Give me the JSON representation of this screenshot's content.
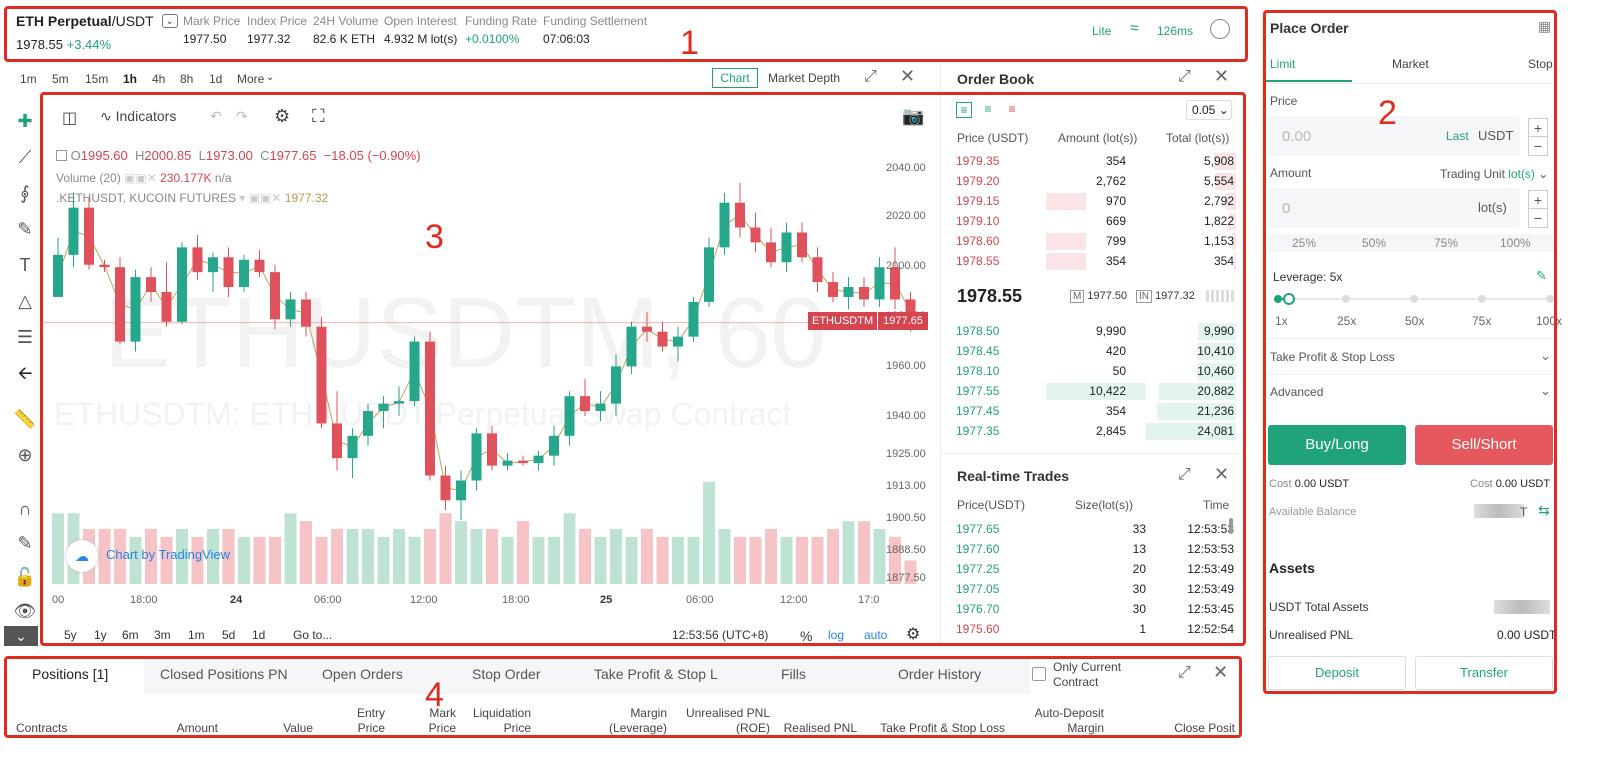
{
  "annotations": [
    "1",
    "2",
    "3",
    "4"
  ],
  "header": {
    "symbol": "ETH Perpetual",
    "quote": "/USDT",
    "last_price": "1978.55",
    "change": "+3.44%",
    "stats": [
      {
        "label": "Mark Price",
        "value": "1977.50"
      },
      {
        "label": "Index Price",
        "value": "1977.32"
      },
      {
        "label": "24H Volume",
        "value": "82.6 K ETH"
      },
      {
        "label": "Open Interest",
        "value": "4.932 M lot(s)"
      },
      {
        "label": "Funding Rate",
        "value": "+0.0100%"
      },
      {
        "label": "Funding Settlement",
        "value": "07:06:03"
      }
    ],
    "mode": "Lite",
    "latency": "126ms"
  },
  "timeframes": [
    "1m",
    "5m",
    "15m",
    "1h",
    "4h",
    "8h",
    "1d",
    "More"
  ],
  "chart_tabs": {
    "chart": "Chart",
    "depth": "Market Depth"
  },
  "chart": {
    "indicators_label": "Indicators",
    "ohlc": {
      "o_label": "O",
      "o": "1995.60",
      "h_label": "H",
      "h": "2000.85",
      "l_label": "L",
      "l": "1973.00",
      "c_label": "C",
      "c": "1977.65",
      "chg": "−18.05 (−0.90%)"
    },
    "volume_label": "Volume (20)",
    "volume_value": "230.177K",
    "volume_na": "n/a",
    "compare_label": ".KETHUSDT, KUCOIN FUTURES",
    "compare_value": "1977.32",
    "watermark_big": "ETHUSDTM, 60",
    "watermark_small": "ETHUSDTM: ETH / USDT Perpetual Swap Contract",
    "price_tag_label": "ETHUSDTM",
    "price_tag_value": "1977.65",
    "y_ticks": [
      "2040.00",
      "2020.00",
      "2000.00",
      "1980.00",
      "1960.00",
      "1940.00",
      "1925.00",
      "1913.00",
      "1900.50",
      "1888.50",
      "1877.50"
    ],
    "x_ticks": [
      "00",
      "18:00",
      "24",
      "06:00",
      "12:00",
      "18:00",
      "25",
      "06:00",
      "12:00",
      "17:0"
    ],
    "tradingview": "Chart by TradingView",
    "ranges": [
      "5y",
      "1y",
      "6m",
      "3m",
      "1m",
      "5d",
      "1d"
    ],
    "goto": "Go to...",
    "clock": "12:53:56 (UTC+8)",
    "pct": "%",
    "log": "log",
    "auto": "auto"
  },
  "chart_data": {
    "type": "candlestick",
    "ohlc": [
      [
        1988,
        2012,
        1990,
        2005
      ],
      [
        2005,
        2030,
        2000,
        2024
      ],
      [
        2024,
        2028,
        1999,
        2001
      ],
      [
        2001,
        2003,
        1998,
        2000
      ],
      [
        2000,
        2004,
        1969,
        1970
      ],
      [
        1970,
        1999,
        1966,
        1996
      ],
      [
        1996,
        2000,
        1986,
        1990
      ],
      [
        1990,
        2002,
        1976,
        1978
      ],
      [
        1978,
        2010,
        1977,
        2008
      ],
      [
        2008,
        2013,
        1995,
        1998
      ],
      [
        1998,
        2006,
        1990,
        2004
      ],
      [
        2004,
        2008,
        1988,
        1992
      ],
      [
        1992,
        2005,
        1990,
        2003
      ],
      [
        2003,
        2007,
        1996,
        1998
      ],
      [
        1998,
        2001,
        1975,
        1979
      ],
      [
        1979,
        1990,
        1976,
        1987
      ],
      [
        1987,
        1990,
        1972,
        1976
      ],
      [
        1976,
        1980,
        1935,
        1937
      ],
      [
        1937,
        1950,
        1918,
        1923
      ],
      [
        1923,
        1935,
        1915,
        1932
      ],
      [
        1932,
        1945,
        1928,
        1942
      ],
      [
        1942,
        1948,
        1935,
        1945
      ],
      [
        1945,
        1952,
        1940,
        1946
      ],
      [
        1946,
        1972,
        1944,
        1970
      ],
      [
        1970,
        1974,
        1914,
        1916
      ],
      [
        1916,
        1920,
        1902,
        1906
      ],
      [
        1906,
        1918,
        1898,
        1914
      ],
      [
        1914,
        1935,
        1910,
        1933
      ],
      [
        1933,
        1936,
        1918,
        1920
      ],
      [
        1920,
        1925,
        1918,
        1922
      ],
      [
        1922,
        1924,
        1920,
        1921
      ],
      [
        1921,
        1926,
        1918,
        1924
      ],
      [
        1924,
        1936,
        1920,
        1932
      ],
      [
        1932,
        1950,
        1928,
        1948
      ],
      [
        1948,
        1955,
        1940,
        1942
      ],
      [
        1942,
        1950,
        1938,
        1945
      ],
      [
        1945,
        1965,
        1940,
        1960
      ],
      [
        1960,
        1978,
        1957,
        1976
      ],
      [
        1976,
        1982,
        1970,
        1974
      ],
      [
        1974,
        1978,
        1966,
        1968
      ],
      [
        1968,
        1976,
        1962,
        1972
      ],
      [
        1972,
        1988,
        1970,
        1986
      ],
      [
        1986,
        2012,
        1984,
        2008
      ],
      [
        2008,
        2030,
        2005,
        2026
      ],
      [
        2026,
        2034,
        2012,
        2016
      ],
      [
        2016,
        2022,
        2006,
        2010
      ],
      [
        2010,
        2016,
        2000,
        2002
      ],
      [
        2002,
        2018,
        1998,
        2014
      ],
      [
        2014,
        2018,
        2002,
        2004
      ],
      [
        2004,
        2008,
        1990,
        1994
      ],
      [
        1994,
        1998,
        1986,
        1988
      ],
      [
        1988,
        1996,
        1983,
        1992
      ],
      [
        1992,
        1996,
        1984,
        1987
      ],
      [
        1987,
        2004,
        1984,
        2000
      ],
      [
        2000,
        2008,
        1983,
        1987
      ],
      [
        1987,
        1990,
        1974,
        1977.65
      ]
    ],
    "volumes": [
      9,
      9,
      7,
      7,
      7,
      6,
      7,
      6,
      7,
      6,
      7,
      7,
      6,
      6,
      6,
      9,
      8,
      6,
      7,
      7,
      7,
      6,
      7,
      6,
      7,
      9,
      8,
      7,
      7,
      6,
      8,
      6,
      6,
      9,
      7,
      6,
      7,
      6,
      7,
      6,
      6,
      6,
      13,
      7,
      6,
      6,
      7,
      6,
      6,
      6,
      7,
      8,
      8,
      7,
      6,
      3
    ]
  },
  "order_book": {
    "title": "Order Book",
    "precision": "0.05",
    "cols": [
      "Price (USDT)",
      "Amount (lot(s))",
      "Total (lot(s))"
    ],
    "asks": [
      {
        "price": "1979.35",
        "amount": "354",
        "total": "5,908",
        "depth": 0.24,
        "amt": 0.0
      },
      {
        "price": "1979.20",
        "amount": "2,762",
        "total": "5,554",
        "depth": 0.23,
        "amt": 0.0
      },
      {
        "price": "1979.15",
        "amount": "970",
        "total": "2,792",
        "depth": 0.12,
        "amt": 0.4
      },
      {
        "price": "1979.10",
        "amount": "669",
        "total": "1,822",
        "depth": 0.08,
        "amt": 0.0
      },
      {
        "price": "1978.60",
        "amount": "799",
        "total": "1,153",
        "depth": 0.05,
        "amt": 0.4
      },
      {
        "price": "1978.55",
        "amount": "354",
        "total": "354",
        "depth": 0.02,
        "amt": 0.4
      }
    ],
    "last": "1978.55",
    "mark_badge": "M",
    "mark": "1977.50",
    "index_badge": "IN",
    "index": "1977.32",
    "bids": [
      {
        "price": "1978.50",
        "amount": "9,990",
        "total": "9,990",
        "depth": 0.42,
        "amt": 0.0
      },
      {
        "price": "1978.45",
        "amount": "420",
        "total": "10,410",
        "depth": 0.43,
        "amt": 0.0
      },
      {
        "price": "1978.10",
        "amount": "50",
        "total": "10,460",
        "depth": 0.43,
        "amt": 0.0
      },
      {
        "price": "1977.55",
        "amount": "10,422",
        "total": "20,882",
        "depth": 0.86,
        "amt": 1.0
      },
      {
        "price": "1977.45",
        "amount": "354",
        "total": "21,236",
        "depth": 0.88,
        "amt": 0.0
      },
      {
        "price": "1977.35",
        "amount": "2,845",
        "total": "24,081",
        "depth": 1.0,
        "amt": 0.0
      }
    ]
  },
  "trades": {
    "title": "Real-time Trades",
    "cols": [
      "Price(USDT)",
      "Size(lot(s))",
      "Time"
    ],
    "rows": [
      {
        "price": "1977.65",
        "size": "33",
        "time": "12:53:53",
        "side": "buy"
      },
      {
        "price": "1977.60",
        "size": "13",
        "time": "12:53:53",
        "side": "buy"
      },
      {
        "price": "1977.25",
        "size": "20",
        "time": "12:53:49",
        "side": "buy"
      },
      {
        "price": "1977.05",
        "size": "30",
        "time": "12:53:49",
        "side": "buy"
      },
      {
        "price": "1976.70",
        "size": "30",
        "time": "12:53:45",
        "side": "buy"
      },
      {
        "price": "1975.60",
        "size": "1",
        "time": "12:52:54",
        "side": "sell"
      }
    ]
  },
  "order_form": {
    "title": "Place Order",
    "tabs": [
      "Limit",
      "Market",
      "Stop"
    ],
    "price_label": "Price",
    "price_placeholder": "0.00",
    "price_last": "Last",
    "price_unit": "USDT",
    "amount_label": "Amount",
    "trading_unit_label": "Trading Unit",
    "trading_unit": "lot(s)",
    "amount_placeholder": "0",
    "amount_unit": "lot(s)",
    "pcts": [
      "25%",
      "50%",
      "75%",
      "100%"
    ],
    "leverage_label": "Leverage: 5x",
    "leverage_level": 0.04,
    "leverage_ticks": [
      "1x",
      "25x",
      "50x",
      "75x",
      "100x"
    ],
    "tpsl": "Take Profit & Stop Loss",
    "advanced": "Advanced",
    "buy": "Buy/Long",
    "sell": "Sell/Short",
    "cost_label": "Cost",
    "cost_buy": "0.00 USDT",
    "cost_sell": "0.00 USDT",
    "available_label": "Available Balance",
    "available_value": "T",
    "assets_title": "Assets",
    "total_assets_label": "USDT Total Assets",
    "unrealised_label": "Unrealised PNL",
    "unrealised_value": "0.00 USDT",
    "deposit": "Deposit",
    "transfer": "Transfer"
  },
  "positions": {
    "tabs": [
      "Positions [1]",
      "Closed Positions PN",
      "Open Orders",
      "Stop Order",
      "Take Profit & Stop L",
      "Fills",
      "Order History"
    ],
    "only_current": "Only Current Contract",
    "columns": [
      {
        "l1": "",
        "l2": "Contracts"
      },
      {
        "l1": "",
        "l2": "Amount"
      },
      {
        "l1": "",
        "l2": "Value"
      },
      {
        "l1": "Entry",
        "l2": "Price"
      },
      {
        "l1": "Mark",
        "l2": "Price"
      },
      {
        "l1": "Liquidation",
        "l2": "Price"
      },
      {
        "l1": "Margin",
        "l2": "(Leverage)"
      },
      {
        "l1": "Unrealised PNL",
        "l2": "(ROE)"
      },
      {
        "l1": "",
        "l2": "Realised PNL"
      },
      {
        "l1": "",
        "l2": "Take Profit & Stop Loss"
      },
      {
        "l1": "Auto-Deposit",
        "l2": "Margin"
      },
      {
        "l1": "",
        "l2": "Close Posit"
      }
    ]
  },
  "colors": {
    "green": "#20a37b",
    "red": "#d5454f",
    "annotation": "#e02b20"
  }
}
